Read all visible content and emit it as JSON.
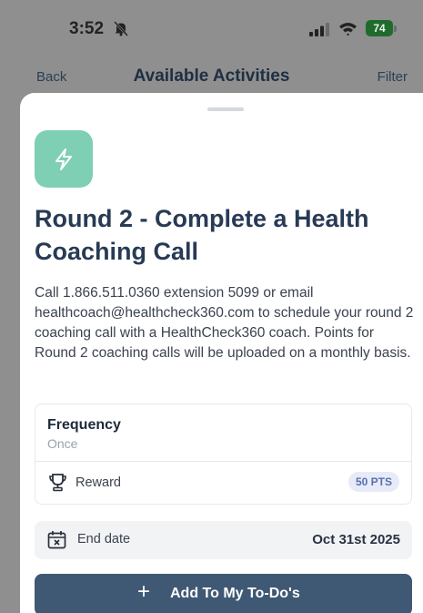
{
  "status_bar": {
    "time": "3:52",
    "battery": "74"
  },
  "nav": {
    "back_label": "Back",
    "title": "Available Activities",
    "filter_label": "Filter"
  },
  "activity": {
    "icon": "lightning-bolt-icon",
    "accent_color": "#7fcfb4",
    "title": "Round 2 - Complete a Health Coaching Call",
    "description": "Call 1.866.511.0360 extension 5099 or email healthcoach@healthcheck360.com to schedule your round 2 coaching call with a HealthCheck360 coach. Points for Round 2 coaching calls will be uploaded on a monthly basis.",
    "frequency_label": "Frequency",
    "frequency_value": "Once",
    "reward_label": "Reward",
    "reward_value": "50 PTS",
    "end_date_label": "End date",
    "end_date_value": "Oct 31st 2025"
  },
  "actions": {
    "add_icon": "+",
    "add_label": "Add To My To-Do's",
    "button_color": "#3f5873"
  }
}
